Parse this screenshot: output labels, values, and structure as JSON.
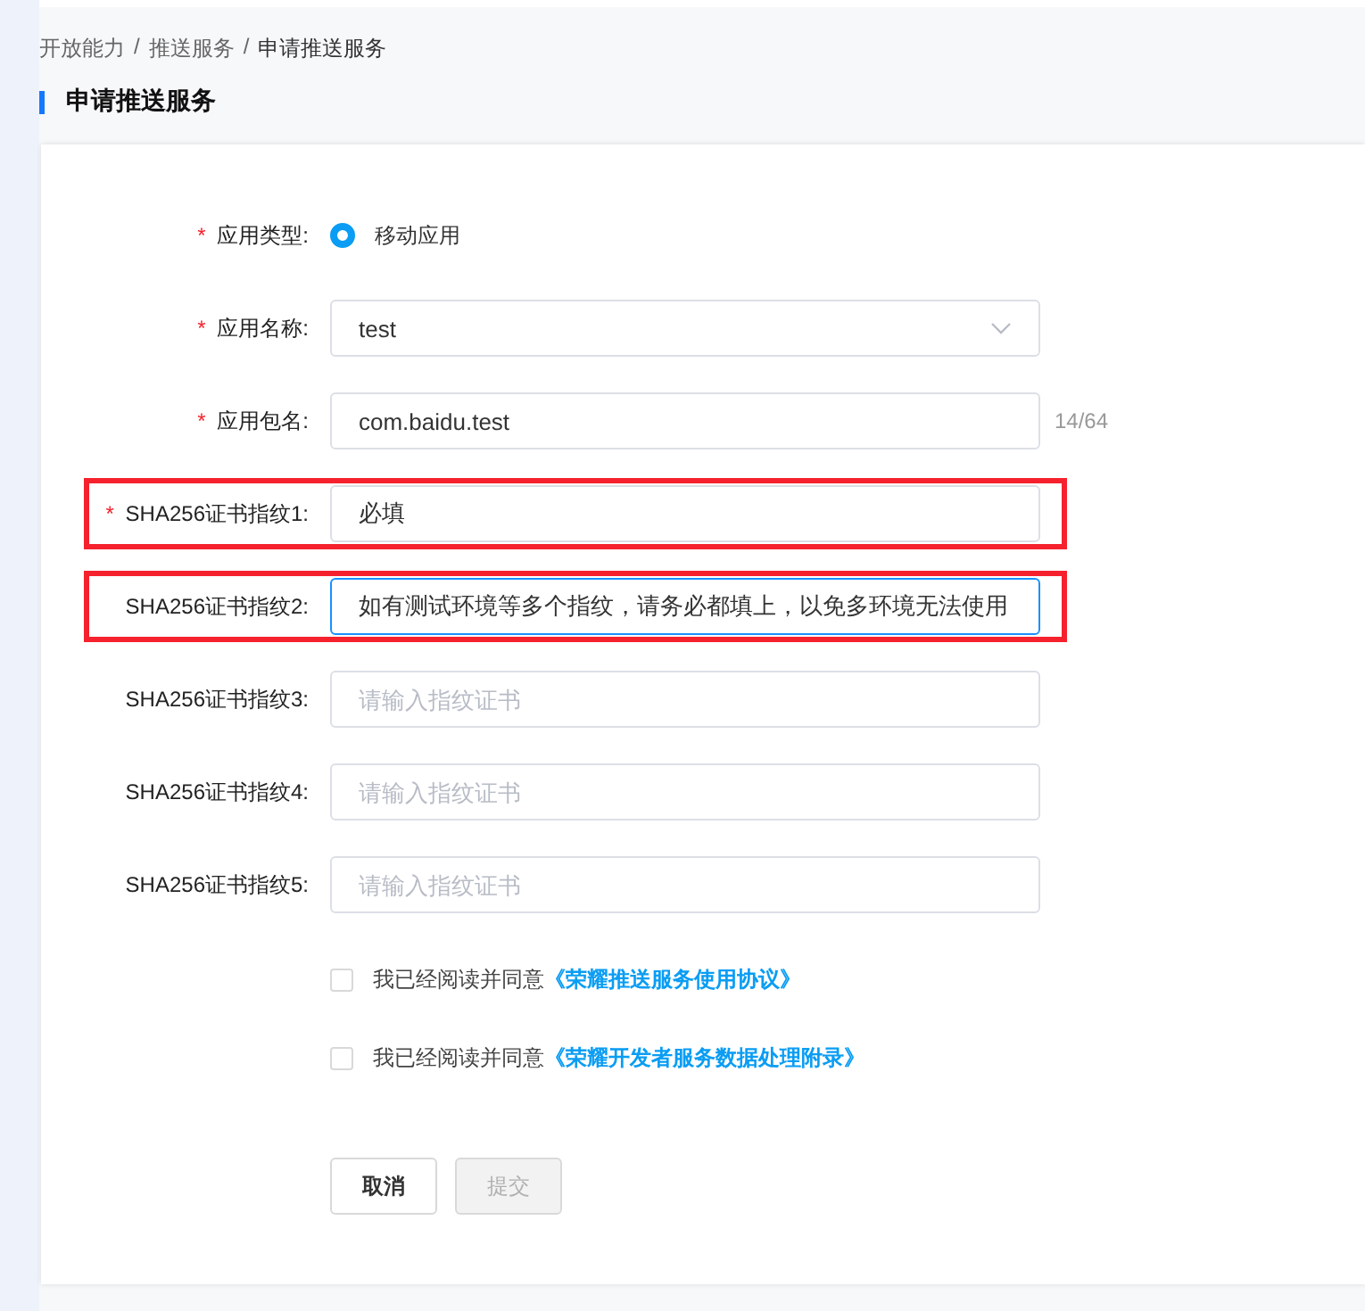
{
  "breadcrumb": [
    {
      "label": "开放能力",
      "current": false
    },
    {
      "label": "推送服务",
      "current": false
    },
    {
      "label": "申请推送服务",
      "current": true
    }
  ],
  "breadcrumb_separator": "/",
  "page_title": "申请推送服务",
  "fields": [
    {
      "kind": "radio",
      "mark": "*",
      "label": "应用类型:",
      "options": [
        {
          "label": "移动应用",
          "selected": true
        }
      ]
    },
    {
      "kind": "select",
      "mark": "*",
      "label": "应用名称:",
      "value": "test"
    },
    {
      "kind": "input",
      "mark": "*",
      "label": "应用包名:",
      "value": "com.baidu.test",
      "counter": "14/64",
      "focused": false
    },
    {
      "kind": "input",
      "mark": "*",
      "label": "SHA256证书指纹1:",
      "value": "必填",
      "highlighted": true,
      "focused": false
    },
    {
      "kind": "input",
      "label": "SHA256证书指纹2:",
      "value": "如有测试环境等多个指纹，请务必都填上，以免多环境无法使用",
      "highlighted": true,
      "focused": true
    },
    {
      "kind": "input",
      "label": "SHA256证书指纹3:",
      "placeholder": "请输入指纹证书",
      "focused": false
    },
    {
      "kind": "input",
      "label": "SHA256证书指纹4:",
      "placeholder": "请输入指纹证书",
      "focused": false
    },
    {
      "kind": "input",
      "label": "SHA256证书指纹5:",
      "placeholder": "请输入指纹证书",
      "focused": false
    }
  ],
  "agreements": [
    {
      "checked": false,
      "text": "我已经阅读并同意",
      "link": "《荣耀推送服务使用协议》"
    },
    {
      "checked": false,
      "text": "我已经阅读并同意",
      "link": "《荣耀开发者服务数据处理附录》"
    }
  ],
  "buttons": [
    {
      "label": "取消",
      "disabled": false
    },
    {
      "label": "提交",
      "disabled": true
    }
  ]
}
